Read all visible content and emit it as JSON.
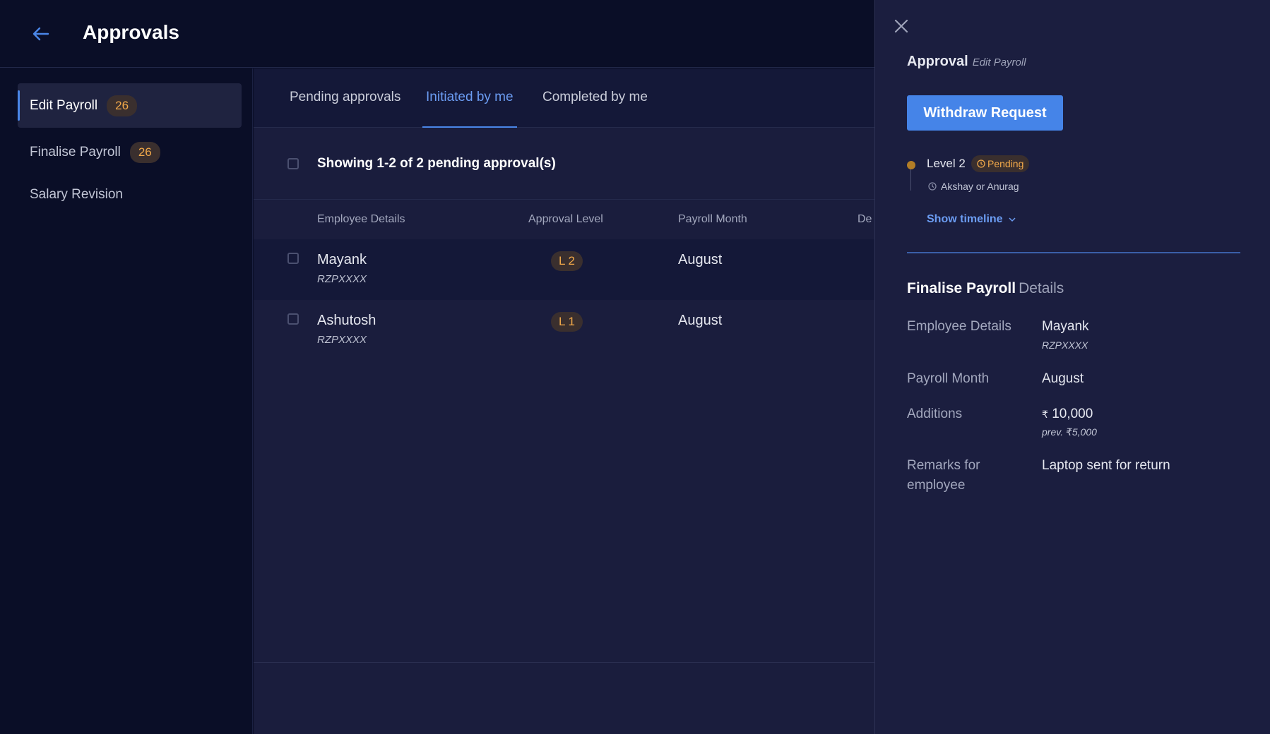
{
  "header": {
    "back_icon": "arrow-left-icon",
    "title": "Approvals"
  },
  "sidebar": {
    "items": [
      {
        "label": "Edit Payroll",
        "count": "26",
        "active": true
      },
      {
        "label": "Finalise Payroll",
        "count": "26",
        "active": false
      },
      {
        "label": "Salary Revision",
        "active": false
      }
    ]
  },
  "tabs": [
    {
      "label": "Pending approvals",
      "active": false
    },
    {
      "label": "Initiated by me",
      "active": true
    },
    {
      "label": "Completed by me",
      "active": false
    }
  ],
  "list": {
    "showing_text": "Showing 1-2 of 2 pending approval(s)",
    "columns": [
      "Employee Details",
      "Approval Level",
      "Payroll Month",
      "De"
    ],
    "rows": [
      {
        "name": "Mayank",
        "id": "RZPXXXX",
        "level": "L 2",
        "month": "August"
      },
      {
        "name": "Ashutosh",
        "id": "RZPXXXX",
        "level": "L 1",
        "month": "August"
      }
    ]
  },
  "panel": {
    "close_icon": "close-icon",
    "title": "Approval",
    "subtitle": "Edit Payroll",
    "withdraw_label": "Withdraw Request",
    "timeline": {
      "level": "Level 2",
      "status": "Pending",
      "approvers": "Akshay or Anurag",
      "show_timeline_label": "Show timeline"
    },
    "details": {
      "title": "Finalise Payroll",
      "title_suffix": "Details",
      "employee_label": "Employee Details",
      "employee_name": "Mayank",
      "employee_id": "RZPXXXX",
      "month_label": "Payroll Month",
      "month_value": "August",
      "additions_label": "Additions",
      "additions_currency": "₹",
      "additions_value": "10,000",
      "additions_prev": "prev. ₹5,000",
      "remarks_label": "Remarks for employee",
      "remarks_value": "Laptop sent for return"
    }
  },
  "colors": {
    "accent": "#4584e8",
    "badge_text": "#f2a94a",
    "badge_bg": "#3a2f2e",
    "background": "#0a0e27"
  }
}
